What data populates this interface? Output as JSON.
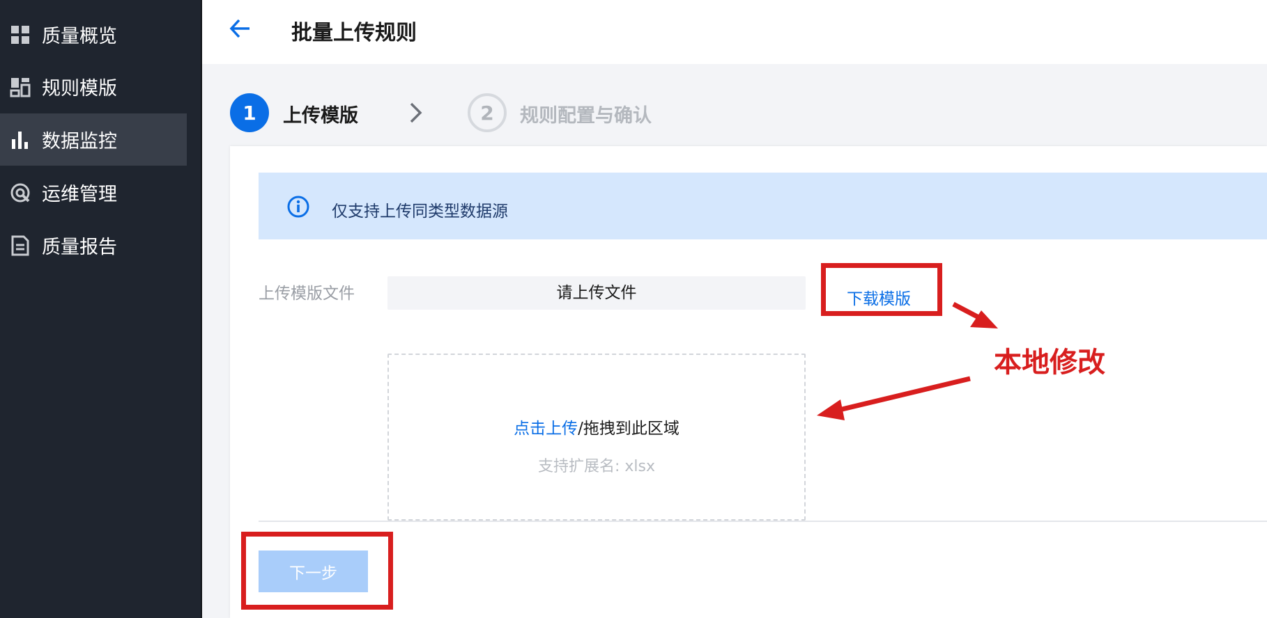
{
  "sidebar": {
    "items": [
      {
        "label": "质量概览",
        "icon": "grid-icon",
        "active": false
      },
      {
        "label": "规则模版",
        "icon": "template-icon",
        "active": false
      },
      {
        "label": "数据监控",
        "icon": "bar-chart-icon",
        "active": true
      },
      {
        "label": "运维管理",
        "icon": "ops-icon",
        "active": false
      },
      {
        "label": "质量报告",
        "icon": "report-icon",
        "active": false
      }
    ]
  },
  "header": {
    "title": "批量上传规则"
  },
  "steps": [
    {
      "number": "1",
      "label": "上传模版",
      "active": true
    },
    {
      "number": "2",
      "label": "规则配置与确认",
      "active": false
    }
  ],
  "info_banner": {
    "text": "仅支持上传同类型数据源"
  },
  "upload": {
    "field_label": "上传模版文件",
    "placeholder": "请上传文件",
    "download_label": "下载模版",
    "dropzone_link": "点击上传",
    "dropzone_text": "/拖拽到此区域",
    "dropzone_hint": "支持扩展名: xlsx"
  },
  "footer": {
    "next_label": "下一步"
  },
  "annotation": {
    "text": "本地修改"
  },
  "colors": {
    "sidebar_bg": "#1f252f",
    "sidebar_active": "#383e49",
    "primary": "#0a6ee6",
    "banner_bg": "#d5e7fd",
    "button_disabled": "#a9cdfa",
    "annotation_red": "#d81e1e"
  }
}
